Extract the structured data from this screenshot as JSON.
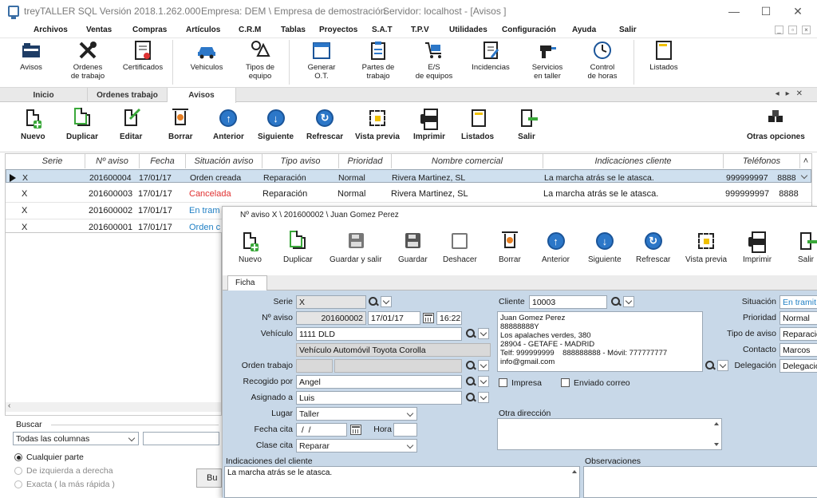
{
  "window": {
    "app_title": "treyTALLER SQL Versión 2018.1.262.000",
    "company": "Empresa: DEM \\ Empresa de demostración",
    "server": "Servidor: localhost - [Avisos    ]"
  },
  "menu": [
    "Archivos",
    "Ventas",
    "Compras",
    "Artículos",
    "C.R.M",
    "Tablas",
    "Proyectos",
    "S.A.T",
    "T.P.V",
    "Utilidades",
    "Configuración",
    "Ayuda",
    "Salir"
  ],
  "ribbon": [
    {
      "label": "Avisos",
      "icon": "folder-icon"
    },
    {
      "label": "Ordenes\nde trabajo",
      "icon": "tools-icon"
    },
    {
      "label": "Certificados",
      "icon": "certificate-icon"
    },
    {
      "label": "Vehiculos",
      "icon": "car-icon"
    },
    {
      "label": "Tipos de\nequipo",
      "icon": "shapes-icon"
    },
    {
      "label": "Generar\nO.T.",
      "icon": "calendar-icon"
    },
    {
      "label": "Partes de\ntrabajo",
      "icon": "clipboard-icon"
    },
    {
      "label": "E/S\nde equipos",
      "icon": "cart-icon"
    },
    {
      "label": "Incidencias",
      "icon": "incident-icon"
    },
    {
      "label": "Servicios\nen taller",
      "icon": "drill-icon"
    },
    {
      "label": "Control\nde horas",
      "icon": "clock-icon"
    },
    {
      "label": "Listados",
      "icon": "list-icon"
    }
  ],
  "tabs": [
    {
      "label": "Inicio",
      "active": false
    },
    {
      "label": "Ordenes trabajo",
      "active": false
    },
    {
      "label": "Avisos",
      "active": true
    }
  ],
  "toolbar": [
    {
      "label": "Nuevo",
      "icon": "new-document-icon"
    },
    {
      "label": "Duplicar",
      "icon": "duplicate-icon"
    },
    {
      "label": "Editar",
      "icon": "edit-icon"
    },
    {
      "label": "Borrar",
      "icon": "trash-icon"
    },
    {
      "label": "Anterior",
      "icon": "arrow-up-icon"
    },
    {
      "label": "Siguiente",
      "icon": "arrow-down-icon"
    },
    {
      "label": "Refrescar",
      "icon": "refresh-icon"
    },
    {
      "label": "Vista previa",
      "icon": "preview-icon"
    },
    {
      "label": "Imprimir",
      "icon": "printer-icon"
    },
    {
      "label": "Listados",
      "icon": "list-icon"
    },
    {
      "label": "Salir",
      "icon": "exit-icon"
    },
    {
      "label": "Otras opciones",
      "icon": "options-icon"
    }
  ],
  "grid": {
    "columns": [
      "Serie",
      "Nº aviso",
      "Fecha",
      "Situación aviso",
      "Tipo aviso",
      "Prioridad",
      "Nombre comercial",
      "Indicaciones cliente",
      "Teléfonos"
    ],
    "rows": [
      {
        "serie": "X",
        "numero": "201600004",
        "fecha": "17/01/17",
        "situacion": "Orden creada",
        "situacion_color": "#1a1a1a",
        "tipo": "Reparación",
        "prioridad": "Normal",
        "nombre": "Rivera Martinez, SL",
        "indicaciones": "La marcha atrás se le atasca.",
        "telefono": "999999997    8888"
      },
      {
        "serie": "X",
        "numero": "201600003",
        "fecha": "17/01/17",
        "situacion": "Cancelada",
        "situacion_color": "#e03030",
        "tipo": "Reparación",
        "prioridad": "Normal",
        "nombre": "Rivera Martinez, SL",
        "indicaciones": "La marcha atrás se le atasca.",
        "telefono": "999999997    8888"
      },
      {
        "serie": "X",
        "numero": "201600002",
        "fecha": "17/01/17",
        "situacion": "En tram",
        "situacion_color": "#1f7fc4"
      },
      {
        "serie": "X",
        "numero": "201600001",
        "fecha": "17/01/17",
        "situacion": "Orden c",
        "situacion_color": "#1f7fc4"
      }
    ]
  },
  "search": {
    "title": "Buscar",
    "column_select": "Todas las columnas",
    "options": [
      "Cualquier parte",
      "De izquierda a derecha",
      "Exacta  ( la más rápida )"
    ],
    "button": "Bu"
  },
  "detail": {
    "title": "Nº aviso X \\ 201600002 \\ Juan Gomez Perez",
    "toolbar": [
      {
        "label": "Nuevo",
        "icon": "new-document-icon"
      },
      {
        "label": "Duplicar",
        "icon": "duplicate-icon"
      },
      {
        "label": "Guardar y salir",
        "icon": "save-exit-icon"
      },
      {
        "label": "Guardar",
        "icon": "save-icon"
      },
      {
        "label": "Deshacer",
        "icon": "undo-icon"
      },
      {
        "label": "Borrar",
        "icon": "trash-icon"
      },
      {
        "label": "Anterior",
        "icon": "arrow-up-icon"
      },
      {
        "label": "Siguiente",
        "icon": "arrow-down-icon"
      },
      {
        "label": "Refrescar",
        "icon": "refresh-icon"
      },
      {
        "label": "Vista previa",
        "icon": "preview-icon"
      },
      {
        "label": "Imprimir",
        "icon": "printer-icon"
      },
      {
        "label": "Salir",
        "icon": "exit-icon"
      }
    ],
    "tab": "Ficha",
    "form": {
      "serie_label": "Serie",
      "serie": "X",
      "naviso_label": "Nº aviso",
      "naviso": "201600002",
      "fecha": "17/01/17",
      "hora": "16:22",
      "vehiculo_label": "Vehículo",
      "vehiculo": "1111 DLD",
      "vehiculo_desc": "Vehículo Automóvil Toyota Corolla",
      "orden_label": "Orden trabajo",
      "recogido_label": "Recogido por",
      "recogido": "Angel",
      "asignado_label": "Asignado a",
      "asignado": "Luis",
      "lugar_label": "Lugar",
      "lugar": "Taller",
      "fechacita_label": "Fecha cita",
      "fechacita": " /  /",
      "hora_label": "Hora",
      "clasecita_label": "Clase cita",
      "clasecita": "Reparar",
      "cliente_label": "Cliente",
      "cliente": "10003",
      "cliente_info": "Juan Gomez Perez\n88888888Y\nLos apalaches verdes, 380\n28904 - GETAFE - MADRID\nTelf: 999999999    888888888 - Móvil: 777777777\ninfo@gmail.com",
      "impresa_label": "Impresa",
      "enviado_label": "Enviado correo",
      "otra_label": "Otra dirección",
      "situacion_label": "Situación",
      "situacion": "En tramit",
      "prioridad_label": "Prioridad",
      "prioridad": "Normal",
      "tipo_label": "Tipo de aviso",
      "tipo": "Reparació",
      "contacto_label": "Contacto",
      "contacto": "Marcos",
      "delegacion_label": "Delegación",
      "delegacion": "Delegació",
      "indicaciones_label": "Indicaciones del cliente",
      "indicaciones": "La marcha atrás se le atasca.",
      "observaciones_label": "Observaciones"
    }
  }
}
